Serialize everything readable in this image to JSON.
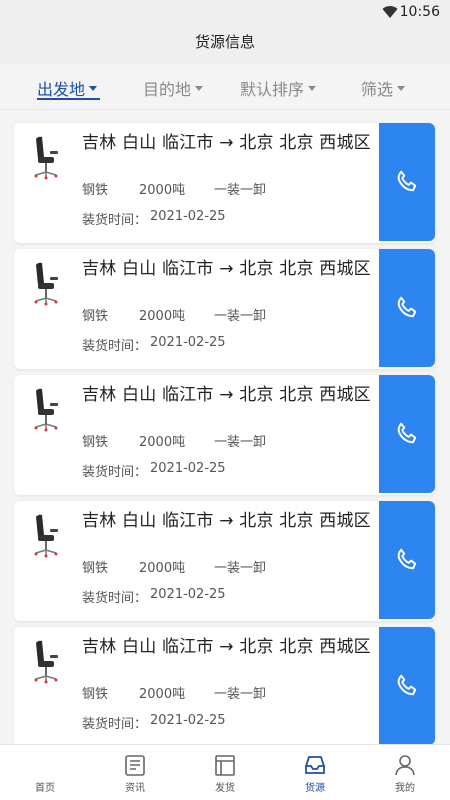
{
  "status_bar": {
    "time": "10:56"
  },
  "header": {
    "title": "货源信息"
  },
  "filters": [
    {
      "label": "出发地",
      "active": true
    },
    {
      "label": "目的地",
      "active": false
    },
    {
      "label": "默认排序",
      "active": false
    },
    {
      "label": "筛选",
      "active": false
    }
  ],
  "listings": [
    {
      "route": "吉林 白山 临江市 → 北京 北京 西城区",
      "cargo": "钢铁",
      "weight": "2000吨",
      "mode": "一装一卸",
      "load_label": "装货时间：",
      "load_date": "2021-02-25"
    },
    {
      "route": "吉林 白山 临江市 → 北京 北京 西城区",
      "cargo": "钢铁",
      "weight": "2000吨",
      "mode": "一装一卸",
      "load_label": "装货时间：",
      "load_date": "2021-02-25"
    },
    {
      "route": "吉林 白山 临江市 → 北京 北京 西城区",
      "cargo": "钢铁",
      "weight": "2000吨",
      "mode": "一装一卸",
      "load_label": "装货时间：",
      "load_date": "2021-02-25"
    },
    {
      "route": "吉林 白山 临江市 → 北京 北京 西城区",
      "cargo": "钢铁",
      "weight": "2000吨",
      "mode": "一装一卸",
      "load_label": "装货时间：",
      "load_date": "2021-02-25"
    },
    {
      "route": "吉林 白山 临江市 → 北京 北京 西城区",
      "cargo": "钢铁",
      "weight": "2000吨",
      "mode": "一装一卸",
      "load_label": "装货时间：",
      "load_date": "2021-02-25"
    }
  ],
  "tabs": [
    {
      "label": "首页",
      "icon": "home-icon",
      "active": false
    },
    {
      "label": "资讯",
      "icon": "news-icon",
      "active": false
    },
    {
      "label": "发货",
      "icon": "shipping-icon",
      "active": false
    },
    {
      "label": "货源",
      "icon": "inbox-icon",
      "active": true
    },
    {
      "label": "我的",
      "icon": "user-icon",
      "active": false
    }
  ],
  "colors": {
    "accent": "#1f4fa8",
    "call_button": "#2d86f0",
    "background": "#f4f4f4"
  }
}
